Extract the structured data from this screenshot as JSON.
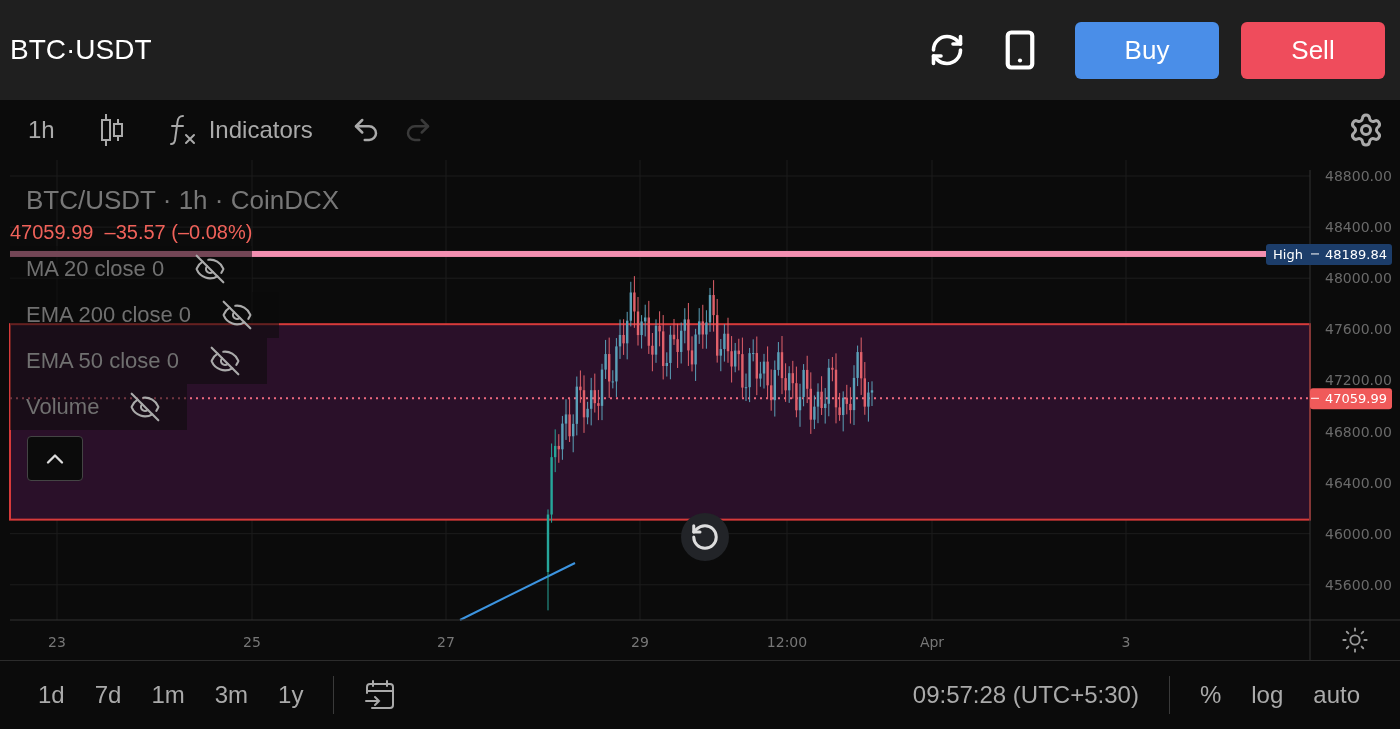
{
  "header": {
    "symbol": "BTC·USDT",
    "buttons": [
      {
        "label": "Buy",
        "kind": "buy"
      },
      {
        "label": "Sell",
        "kind": "sell"
      }
    ]
  },
  "toolbar": {
    "interval": "1h",
    "indicators_label": "Indicators",
    "undo": {
      "disabled": false
    },
    "redo": {
      "disabled": true
    }
  },
  "chart": {
    "title": "BTC/USDT · 1h · CoinDCX",
    "last": "47059.99",
    "change": "–35.57 (–0.08%)",
    "studies": [
      {
        "label": "MA 20 close 0",
        "visible": false
      },
      {
        "label": "EMA 200 close 0",
        "visible": false
      },
      {
        "label": "EMA 50 close 0",
        "visible": false
      },
      {
        "label": "Volume",
        "visible": false
      }
    ],
    "price_ticks": [
      "48800.00",
      "48400.00",
      "48000.00",
      "47600.00",
      "47200.00",
      "46800.00",
      "46400.00",
      "46000.00",
      "45600.00"
    ],
    "time_ticks": [
      "23",
      "25",
      "27",
      "29",
      "12:00",
      "Apr",
      "3"
    ],
    "high": {
      "label": "High",
      "value": "48189.84"
    },
    "current_price": "47059.99"
  },
  "footer": {
    "ranges": [
      "1d",
      "7d",
      "1m",
      "3m",
      "1y"
    ],
    "time": "09:57:28 (UTC+5:30)",
    "options": [
      "%",
      "log",
      "auto"
    ]
  }
}
